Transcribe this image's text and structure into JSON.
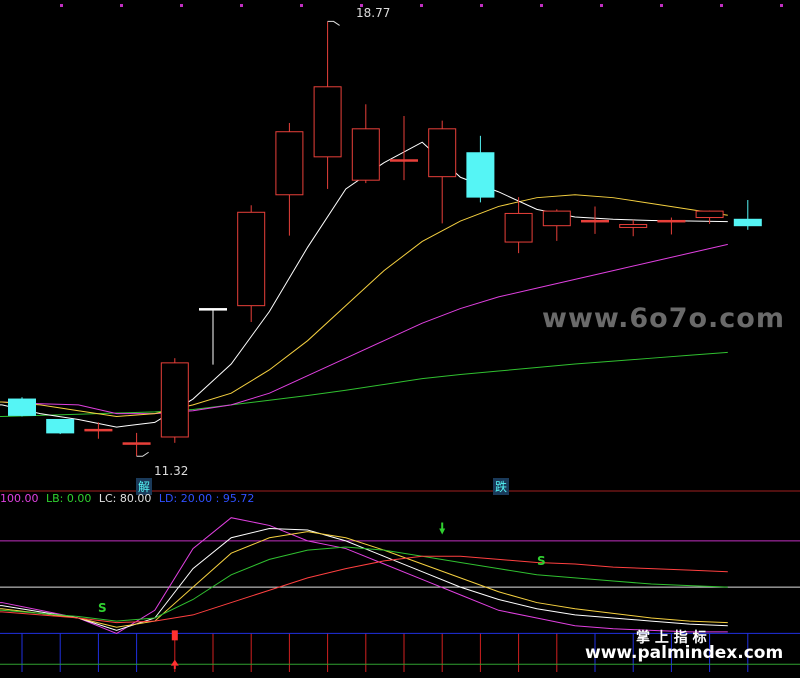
{
  "chart_data": [
    {
      "type": "candlestick",
      "title": "",
      "annotations": {
        "high_label": "18.77",
        "low_label": "11.32",
        "marker_1": "解",
        "marker_2": "跌"
      },
      "colors": {
        "up": "#e8403a",
        "down": "#55f5f5",
        "doji": "#ffffff",
        "ma5": "#ffffff",
        "ma10": "#f5d040",
        "ma20": "#e040e0",
        "ma60": "#30c030"
      },
      "candles": [
        {
          "o": 12.3,
          "h": 12.33,
          "l": 12.0,
          "c": 12.02
        },
        {
          "o": 11.95,
          "h": 11.95,
          "l": 11.7,
          "c": 11.72
        },
        {
          "o": 11.76,
          "h": 11.9,
          "l": 11.62,
          "c": 11.78
        },
        {
          "o": 11.55,
          "h": 11.72,
          "l": 11.32,
          "c": 11.55
        },
        {
          "o": 11.65,
          "h": 13.0,
          "l": 11.55,
          "c": 12.92
        },
        {
          "o": 13.85,
          "h": 13.85,
          "l": 12.89,
          "c": 13.85
        },
        {
          "o": 13.9,
          "h": 15.62,
          "l": 13.62,
          "c": 15.5
        },
        {
          "o": 15.8,
          "h": 17.03,
          "l": 15.1,
          "c": 16.88
        },
        {
          "o": 16.45,
          "h": 18.77,
          "l": 15.9,
          "c": 17.65
        },
        {
          "o": 16.05,
          "h": 17.35,
          "l": 16.0,
          "c": 16.93
        },
        {
          "o": 16.4,
          "h": 17.15,
          "l": 16.05,
          "c": 16.38
        },
        {
          "o": 16.11,
          "h": 17.07,
          "l": 15.31,
          "c": 16.93
        },
        {
          "o": 16.52,
          "h": 16.81,
          "l": 15.67,
          "c": 15.76
        },
        {
          "o": 14.99,
          "h": 15.76,
          "l": 14.8,
          "c": 15.48
        },
        {
          "o": 15.27,
          "h": 15.55,
          "l": 15.01,
          "c": 15.52
        },
        {
          "o": 15.36,
          "h": 15.6,
          "l": 15.13,
          "c": 15.36
        },
        {
          "o": 15.24,
          "h": 15.37,
          "l": 15.09,
          "c": 15.29
        },
        {
          "o": 15.36,
          "h": 15.41,
          "l": 15.12,
          "c": 15.34
        },
        {
          "o": 15.41,
          "h": 15.53,
          "l": 15.3,
          "c": 15.52
        },
        {
          "o": 15.38,
          "h": 15.71,
          "l": 15.2,
          "c": 15.27
        }
      ],
      "ma": {
        "ma5": [
          12.2,
          12.05,
          11.95,
          11.82,
          11.9,
          12.3,
          12.9,
          13.8,
          14.9,
          15.9,
          16.35,
          16.7,
          16.1,
          15.85,
          15.55,
          15.42,
          15.38,
          15.36,
          15.35,
          15.34
        ],
        "ma10": [
          12.25,
          12.2,
          12.1,
          12.0,
          12.05,
          12.2,
          12.4,
          12.8,
          13.3,
          13.9,
          14.5,
          15.0,
          15.35,
          15.6,
          15.75,
          15.8,
          15.75,
          15.65,
          15.55,
          15.45
        ],
        "ma20": [
          12.25,
          12.22,
          12.2,
          12.05,
          12.05,
          12.1,
          12.2,
          12.4,
          12.7,
          13.0,
          13.3,
          13.6,
          13.85,
          14.05,
          14.2,
          14.35,
          14.5,
          14.65,
          14.8,
          14.95
        ],
        "ma60": [
          12.0,
          12.02,
          12.04,
          12.06,
          12.08,
          12.12,
          12.2,
          12.28,
          12.36,
          12.45,
          12.55,
          12.65,
          12.72,
          12.78,
          12.84,
          12.9,
          12.95,
          13.0,
          13.05,
          13.1
        ]
      },
      "ylim": [
        11.05,
        19.0
      ]
    },
    {
      "type": "line",
      "legend_items": [
        {
          "text": "100.00",
          "color": "#e040e0"
        },
        {
          "text": "LB: 0.00",
          "color": "#30d030"
        },
        {
          "text": "LC: 80.00",
          "color": "#e0e0e0"
        },
        {
          "text": "LD: 20.00 : 95.72",
          "color": "#3050ff"
        }
      ],
      "markers": {
        "s": "S",
        "jue": "掌"
      },
      "hlines": [
        80,
        50,
        20,
        0
      ],
      "ylim": [
        -5,
        100
      ],
      "series": [
        {
          "color": "#e040e0",
          "values": [
            40,
            35,
            30,
            20,
            35,
            75,
            95,
            90,
            80,
            75,
            65,
            55,
            45,
            35,
            30,
            25,
            23,
            22,
            21,
            21
          ]
        },
        {
          "color": "#ffffff",
          "values": [
            38,
            34,
            30,
            22,
            30,
            62,
            82,
            88,
            87,
            80,
            70,
            60,
            50,
            42,
            36,
            32,
            30,
            28,
            26,
            25
          ]
        },
        {
          "color": "#f5d040",
          "values": [
            36,
            33,
            30,
            24,
            28,
            50,
            72,
            82,
            86,
            82,
            74,
            65,
            56,
            47,
            40,
            36,
            33,
            30,
            28,
            27
          ]
        },
        {
          "color": "#30c030",
          "values": [
            35,
            33,
            31,
            28,
            30,
            42,
            58,
            68,
            74,
            76,
            74,
            70,
            66,
            62,
            58,
            56,
            54,
            52,
            51,
            50
          ]
        },
        {
          "color": "#ff4040",
          "values": [
            34,
            32,
            30,
            27,
            28,
            32,
            40,
            48,
            56,
            62,
            67,
            70,
            70,
            68,
            66,
            65,
            63,
            62,
            61,
            60
          ]
        }
      ]
    }
  ],
  "watermarks": {
    "top": "www.6o7o.com",
    "bottom_cn": "掌 上 指 标",
    "bottom_url": "www.palmindex.com"
  }
}
